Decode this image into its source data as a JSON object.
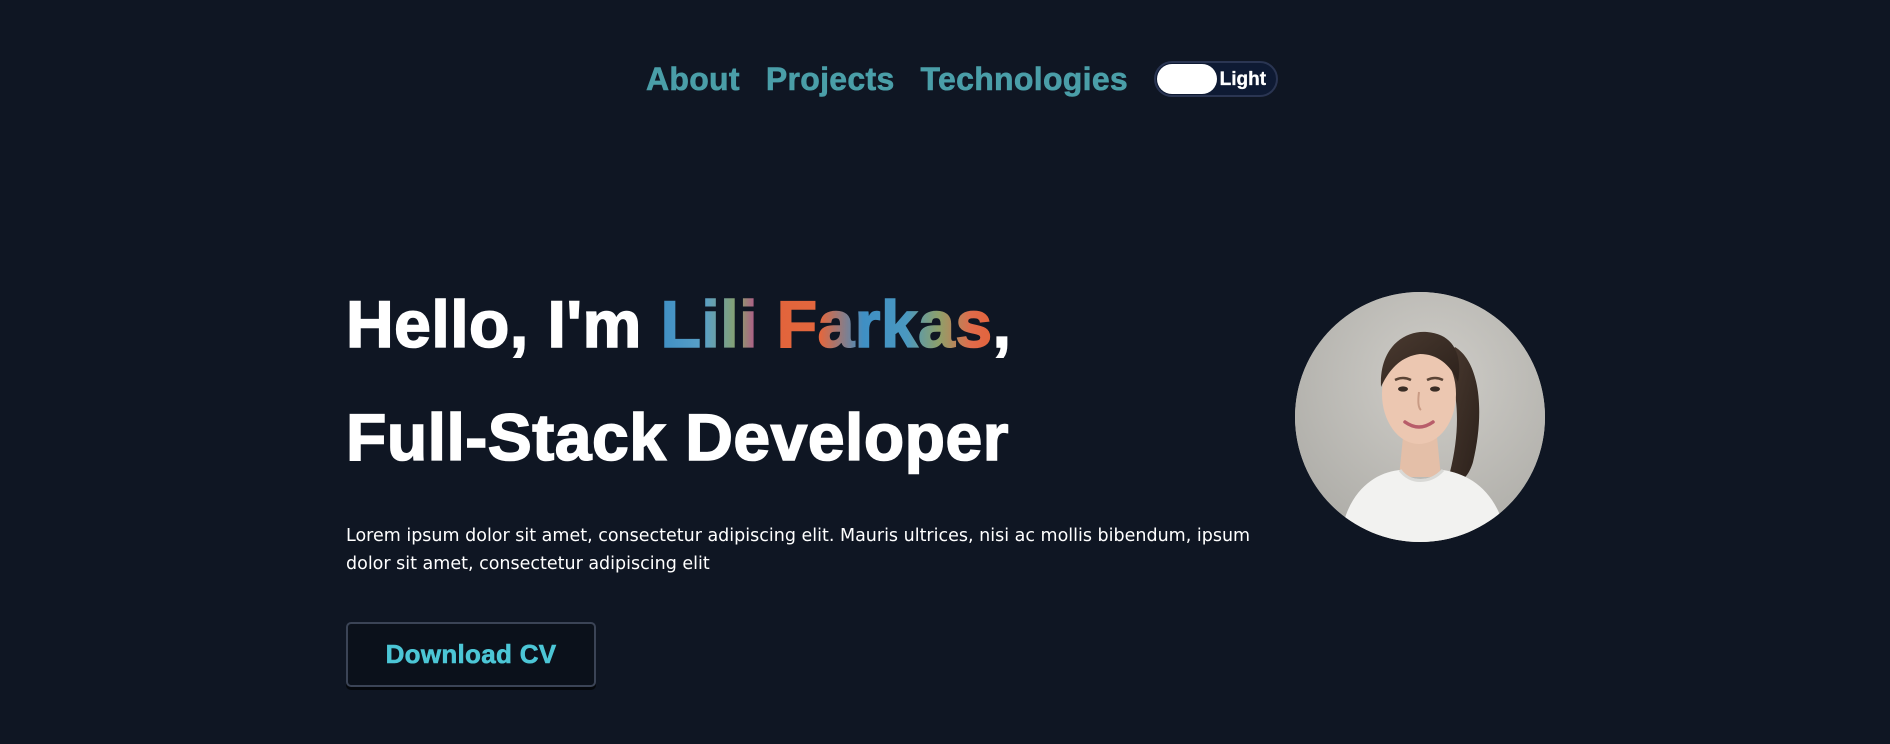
{
  "nav": {
    "items": [
      {
        "label": "About"
      },
      {
        "label": "Projects"
      },
      {
        "label": "Technologies"
      }
    ],
    "theme_toggle": {
      "label": "Light",
      "state": "dark"
    }
  },
  "hero": {
    "greeting": "Hello, I'm ",
    "first_name": "Lili",
    "last_name": "Farkas",
    "comma": ",",
    "role": "Full-Stack Developer",
    "description": "Lorem ipsum dolor sit amet, consectetur adipiscing elit. Mauris ultrices, nisi ac mollis bibendum, ipsum dolor sit amet, consectetur adipiscing elit",
    "cta_label": "Download CV"
  },
  "colors": {
    "background": "#0f1623",
    "nav_link": "#4a9ea8",
    "cta_text": "#4cc6d6",
    "heading": "#ffffff"
  }
}
